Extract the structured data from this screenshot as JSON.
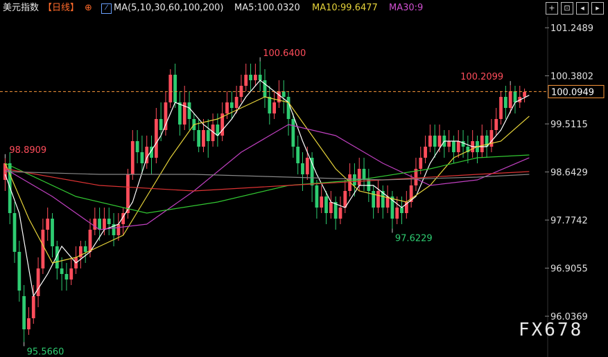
{
  "header": {
    "title": "美元指数",
    "period": "【日线】",
    "circle_icon": "⊕",
    "ma_label": "MA(5,10,30,60,100,200)",
    "ma5": "MA5:100.0320",
    "ma10": "MA10:99.6477",
    "ma30": "MA30:9"
  },
  "toolbar": {
    "icons": [
      "crosshair-icon",
      "target-icon",
      "arrow-left-icon",
      "arrow-right-icon"
    ]
  },
  "watermark": "FX678",
  "colors": {
    "up": "#ff4d5b",
    "down": "#2ecc71",
    "ma5": "#ffffff",
    "ma10": "#e6d33a",
    "ma30": "#c040c0",
    "ma60": "#32c832",
    "ma100": "#dd3333",
    "ma200": "#888888",
    "price_line": "#ff9a3c"
  },
  "chart_data": {
    "type": "candlestick",
    "y_ticks": [
      "101.2489",
      "100.3802",
      "99.5115",
      "98.6429",
      "97.7742",
      "96.9055",
      "96.0369"
    ],
    "ylim": [
      95.3,
      101.45
    ],
    "current_price": "100.0949",
    "annotations": [
      {
        "label": "100.6400",
        "index": 54,
        "kind": "high"
      },
      {
        "label": "100.2099",
        "index": 107,
        "kind": "high"
      },
      {
        "label": "98.8909",
        "index": 0,
        "kind": "high"
      },
      {
        "label": "97.6229",
        "index": 82,
        "kind": "low"
      },
      {
        "label": "95.5660",
        "index": 4,
        "kind": "low"
      }
    ],
    "candles": [
      [
        98.5,
        98.8,
        98.89,
        98.3
      ],
      [
        98.8,
        97.9,
        99.0,
        97.7
      ],
      [
        97.9,
        97.2,
        98.1,
        97.0
      ],
      [
        97.2,
        96.5,
        97.4,
        96.3
      ],
      [
        96.4,
        95.8,
        96.6,
        95.57
      ],
      [
        95.8,
        96.0,
        96.2,
        95.7
      ],
      [
        96.0,
        96.4,
        96.6,
        95.9
      ],
      [
        96.4,
        96.9,
        97.1,
        96.2
      ],
      [
        96.9,
        97.6,
        97.8,
        96.8
      ],
      [
        97.6,
        97.8,
        98.0,
        97.4
      ],
      [
        97.8,
        97.3,
        97.9,
        97.1
      ],
      [
        97.3,
        96.9,
        97.4,
        96.7
      ],
      [
        96.9,
        96.8,
        97.1,
        96.5
      ],
      [
        96.8,
        96.7,
        97.0,
        96.5
      ],
      [
        96.7,
        96.9,
        97.1,
        96.6
      ],
      [
        96.9,
        97.1,
        97.3,
        96.8
      ],
      [
        97.1,
        97.3,
        97.4,
        96.9
      ],
      [
        97.3,
        97.2,
        97.4,
        97.0
      ],
      [
        97.2,
        97.6,
        97.8,
        97.1
      ],
      [
        97.6,
        97.8,
        98.0,
        97.5
      ],
      [
        97.8,
        97.6,
        98.0,
        97.4
      ],
      [
        97.6,
        97.8,
        98.0,
        97.5
      ],
      [
        97.8,
        97.7,
        98.0,
        97.5
      ],
      [
        97.7,
        97.5,
        97.9,
        97.3
      ],
      [
        97.5,
        97.7,
        97.9,
        97.4
      ],
      [
        97.7,
        97.9,
        98.0,
        97.5
      ],
      [
        97.9,
        98.6,
        98.7,
        97.8
      ],
      [
        98.6,
        99.2,
        99.4,
        98.5
      ],
      [
        99.2,
        99.0,
        99.4,
        98.8
      ],
      [
        99.0,
        98.8,
        99.3,
        98.6
      ],
      [
        98.8,
        99.1,
        99.3,
        98.7
      ],
      [
        99.1,
        98.9,
        99.3,
        98.6
      ],
      [
        98.9,
        99.6,
        99.8,
        98.8
      ],
      [
        99.6,
        99.4,
        99.9,
        99.2
      ],
      [
        99.4,
        99.9,
        100.1,
        99.3
      ],
      [
        99.9,
        100.4,
        100.5,
        99.8
      ],
      [
        100.4,
        99.9,
        100.6,
        99.8
      ],
      [
        99.9,
        99.5,
        100.1,
        99.3
      ],
      [
        99.5,
        99.9,
        100.2,
        99.4
      ],
      [
        99.9,
        99.6,
        100.1,
        99.4
      ],
      [
        99.6,
        99.4,
        99.7,
        99.2
      ],
      [
        99.4,
        99.1,
        99.6,
        99.0
      ],
      [
        99.1,
        99.4,
        99.6,
        99.0
      ],
      [
        99.4,
        99.2,
        99.6,
        98.9
      ],
      [
        99.2,
        99.5,
        99.7,
        99.1
      ],
      [
        99.5,
        99.3,
        99.7,
        99.1
      ],
      [
        99.3,
        99.7,
        99.9,
        99.2
      ],
      [
        99.7,
        99.9,
        100.1,
        99.6
      ],
      [
        99.9,
        99.8,
        100.1,
        99.6
      ],
      [
        99.8,
        100.0,
        100.2,
        99.7
      ],
      [
        100.0,
        100.2,
        100.4,
        99.9
      ],
      [
        100.2,
        100.4,
        100.6,
        100.1
      ],
      [
        100.4,
        100.3,
        100.6,
        100.1
      ],
      [
        100.3,
        100.4,
        100.6,
        100.2
      ],
      [
        100.4,
        100.3,
        100.64,
        100.1
      ],
      [
        100.3,
        100.0,
        100.5,
        99.8
      ],
      [
        100.0,
        99.7,
        100.2,
        99.5
      ],
      [
        99.7,
        99.9,
        100.1,
        99.6
      ],
      [
        99.9,
        100.1,
        100.3,
        99.8
      ],
      [
        100.1,
        100.0,
        100.3,
        99.7
      ],
      [
        100.0,
        99.6,
        100.1,
        99.3
      ],
      [
        99.6,
        99.1,
        99.7,
        98.9
      ],
      [
        99.1,
        98.8,
        99.3,
        98.6
      ],
      [
        98.8,
        98.6,
        99.0,
        98.3
      ],
      [
        98.6,
        98.9,
        99.1,
        98.5
      ],
      [
        98.9,
        98.4,
        99.0,
        98.1
      ],
      [
        98.4,
        98.0,
        98.5,
        97.8
      ],
      [
        98.0,
        98.2,
        98.4,
        97.9
      ],
      [
        98.2,
        97.9,
        98.3,
        97.7
      ],
      [
        97.9,
        98.1,
        98.3,
        97.8
      ],
      [
        98.1,
        97.8,
        98.2,
        97.6
      ],
      [
        97.8,
        98.0,
        98.2,
        97.7
      ],
      [
        98.0,
        98.3,
        98.5,
        97.9
      ],
      [
        98.3,
        98.6,
        98.8,
        98.2
      ],
      [
        98.6,
        98.4,
        98.8,
        98.2
      ],
      [
        98.4,
        98.7,
        98.9,
        98.3
      ],
      [
        98.7,
        98.5,
        98.9,
        98.3
      ],
      [
        98.5,
        98.3,
        98.7,
        98.1
      ],
      [
        98.3,
        98.0,
        98.4,
        97.8
      ],
      [
        98.0,
        98.3,
        98.5,
        97.9
      ],
      [
        98.3,
        98.0,
        98.4,
        97.8
      ],
      [
        98.0,
        98.2,
        98.4,
        97.9
      ],
      [
        98.2,
        97.8,
        98.3,
        97.62
      ],
      [
        97.8,
        98.0,
        98.2,
        97.7
      ],
      [
        98.0,
        97.9,
        98.2,
        97.7
      ],
      [
        97.9,
        98.1,
        98.3,
        97.8
      ],
      [
        98.1,
        98.4,
        98.6,
        98.0
      ],
      [
        98.4,
        98.7,
        98.9,
        98.3
      ],
      [
        98.7,
        98.9,
        99.1,
        98.6
      ],
      [
        98.9,
        99.1,
        99.3,
        98.8
      ],
      [
        99.1,
        99.3,
        99.5,
        99.0
      ],
      [
        99.3,
        99.1,
        99.5,
        98.9
      ],
      [
        99.1,
        99.3,
        99.5,
        99.0
      ],
      [
        99.3,
        99.1,
        99.4,
        98.9
      ],
      [
        99.1,
        99.2,
        99.4,
        99.0
      ],
      [
        99.2,
        99.0,
        99.3,
        98.8
      ],
      [
        99.0,
        99.2,
        99.4,
        98.9
      ],
      [
        99.2,
        99.1,
        99.4,
        98.9
      ],
      [
        99.1,
        99.0,
        99.3,
        98.8
      ],
      [
        99.0,
        99.2,
        99.4,
        98.9
      ],
      [
        99.2,
        99.0,
        99.3,
        98.8
      ],
      [
        99.0,
        99.3,
        99.5,
        98.9
      ],
      [
        99.3,
        99.1,
        99.4,
        98.9
      ],
      [
        99.1,
        99.4,
        99.6,
        99.0
      ],
      [
        99.4,
        99.6,
        99.8,
        99.3
      ],
      [
        99.6,
        100.0,
        100.1,
        99.5
      ],
      [
        100.0,
        99.8,
        100.2,
        99.6
      ],
      [
        99.8,
        100.1,
        100.21,
        99.7
      ],
      [
        100.1,
        99.9,
        100.2,
        99.7
      ],
      [
        99.9,
        100.0,
        100.2,
        99.8
      ],
      [
        100.0,
        100.09,
        100.15,
        99.9
      ]
    ],
    "ma_lines": [
      {
        "name": "MA5",
        "color_key": "ma5",
        "values": [
          [
            0,
            98.6
          ],
          [
            3,
            97.9
          ],
          [
            6,
            96.4
          ],
          [
            9,
            96.8
          ],
          [
            12,
            97.3
          ],
          [
            15,
            97.0
          ],
          [
            18,
            97.2
          ],
          [
            21,
            97.6
          ],
          [
            24,
            97.7
          ],
          [
            27,
            98.1
          ],
          [
            30,
            98.9
          ],
          [
            33,
            99.3
          ],
          [
            36,
            99.9
          ],
          [
            39,
            99.8
          ],
          [
            42,
            99.5
          ],
          [
            45,
            99.3
          ],
          [
            48,
            99.6
          ],
          [
            51,
            100.0
          ],
          [
            54,
            100.3
          ],
          [
            57,
            100.1
          ],
          [
            60,
            99.9
          ],
          [
            63,
            99.2
          ],
          [
            66,
            98.6
          ],
          [
            69,
            98.1
          ],
          [
            72,
            98.0
          ],
          [
            75,
            98.4
          ],
          [
            78,
            98.4
          ],
          [
            81,
            98.2
          ],
          [
            84,
            98.0
          ],
          [
            87,
            98.2
          ],
          [
            90,
            98.8
          ],
          [
            93,
            99.2
          ],
          [
            96,
            99.2
          ],
          [
            99,
            99.1
          ],
          [
            102,
            99.1
          ],
          [
            105,
            99.4
          ],
          [
            108,
            99.9
          ],
          [
            111,
            100.03
          ]
        ]
      },
      {
        "name": "MA10",
        "color_key": "ma10",
        "values": [
          [
            0,
            98.8
          ],
          [
            5,
            97.8
          ],
          [
            10,
            97.0
          ],
          [
            15,
            97.1
          ],
          [
            20,
            97.3
          ],
          [
            25,
            97.5
          ],
          [
            30,
            98.2
          ],
          [
            35,
            98.9
          ],
          [
            40,
            99.5
          ],
          [
            45,
            99.6
          ],
          [
            50,
            99.8
          ],
          [
            55,
            100.0
          ],
          [
            60,
            99.9
          ],
          [
            65,
            99.3
          ],
          [
            70,
            98.7
          ],
          [
            75,
            98.3
          ],
          [
            80,
            98.2
          ],
          [
            85,
            98.1
          ],
          [
            90,
            98.4
          ],
          [
            95,
            98.9
          ],
          [
            100,
            99.1
          ],
          [
            105,
            99.2
          ],
          [
            111,
            99.65
          ]
        ]
      },
      {
        "name": "MA30",
        "color_key": "ma30",
        "values": [
          [
            0,
            98.7
          ],
          [
            10,
            98.2
          ],
          [
            20,
            97.6
          ],
          [
            30,
            97.7
          ],
          [
            40,
            98.3
          ],
          [
            50,
            99.0
          ],
          [
            60,
            99.5
          ],
          [
            70,
            99.3
          ],
          [
            80,
            98.8
          ],
          [
            90,
            98.4
          ],
          [
            100,
            98.5
          ],
          [
            111,
            98.9
          ]
        ]
      },
      {
        "name": "MA60",
        "color_key": "ma60",
        "values": [
          [
            0,
            98.8
          ],
          [
            15,
            98.2
          ],
          [
            30,
            97.9
          ],
          [
            45,
            98.1
          ],
          [
            60,
            98.4
          ],
          [
            75,
            98.5
          ],
          [
            90,
            98.7
          ],
          [
            100,
            98.9
          ],
          [
            111,
            98.95
          ]
        ]
      },
      {
        "name": "MA100",
        "color_key": "ma100",
        "values": [
          [
            0,
            98.7
          ],
          [
            20,
            98.4
          ],
          [
            40,
            98.3
          ],
          [
            60,
            98.4
          ],
          [
            80,
            98.5
          ],
          [
            100,
            98.6
          ],
          [
            111,
            98.65
          ]
        ]
      },
      {
        "name": "MA200",
        "color_key": "ma200",
        "values": [
          [
            0,
            98.65
          ],
          [
            20,
            98.6
          ],
          [
            40,
            98.6
          ],
          [
            60,
            98.55
          ],
          [
            80,
            98.5
          ],
          [
            100,
            98.55
          ],
          [
            111,
            98.6
          ]
        ]
      }
    ]
  }
}
